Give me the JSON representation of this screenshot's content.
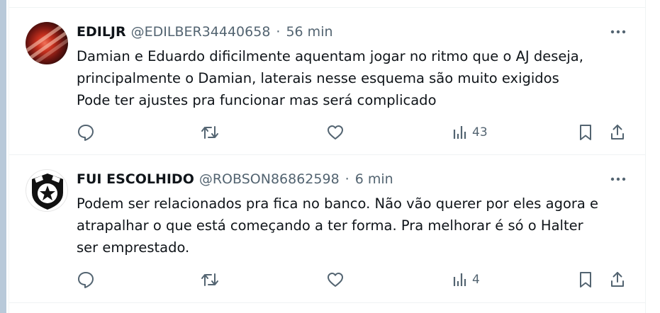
{
  "tweets": [
    {
      "name": "EDILJR",
      "handle": "@EDILBER34440658",
      "separator": "·",
      "time": "56 min",
      "lines": [
        "Damian e Eduardo dificilmente aquentam jogar no ritmo que o AJ deseja,",
        "principalmente o Damian, laterais nesse esquema são muito exigidos",
        "Pode ter ajustes pra funcionar mas será complicado"
      ],
      "views": "43"
    },
    {
      "name": "FUI ESCOLHIDO",
      "handle": "@ROBSON86862598",
      "separator": "·",
      "time": "6 min",
      "lines": [
        "Podem ser relacionados pra fica no banco. Não vão querer por eles agora e",
        "atrapalhar o que está começando a ter forma. Pra melhorar é só o Halter",
        "ser emprestado."
      ],
      "views": "4"
    }
  ],
  "icons": {
    "more": "more-horizontal-icon",
    "reply": "reply-icon",
    "retweet": "retweet-icon",
    "like": "heart-icon",
    "views": "views-bar-chart-icon",
    "bookmark": "bookmark-icon",
    "share": "share-icon"
  },
  "colors": {
    "text_primary": "#0f1419",
    "text_secondary": "#536471",
    "divider": "#eff3f4",
    "left_rail": "#b8c9d9"
  }
}
